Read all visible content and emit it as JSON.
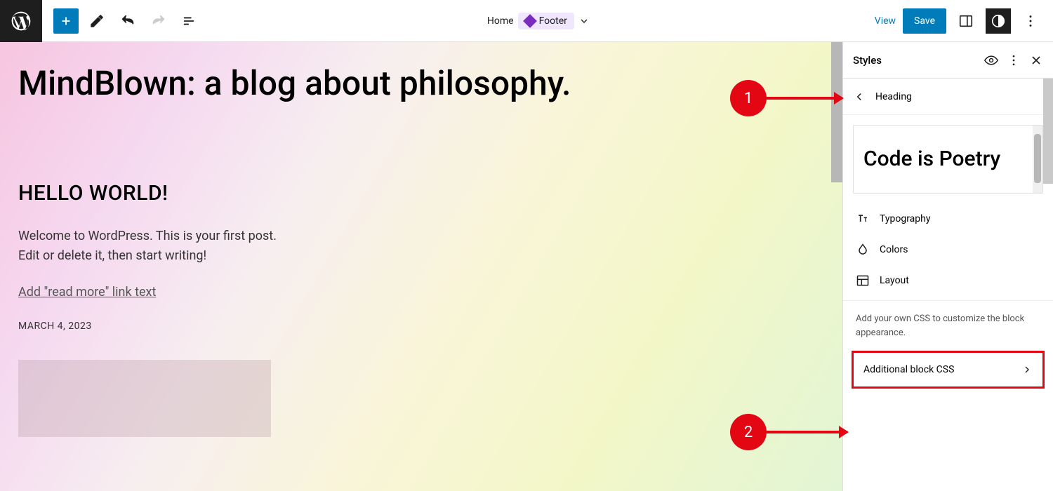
{
  "toolbar": {
    "center_home": "Home",
    "center_footer": "Footer",
    "view_label": "View",
    "save_label": "Save"
  },
  "canvas": {
    "site_title": "MindBlown: a blog about philosophy.",
    "post_title": "HELLO WORLD!",
    "post_excerpt": "Welcome to WordPress. This is your first post. Edit or delete it, then start writing!",
    "readmore_label": "Add \"read more\" link text",
    "post_date": "MARCH 4, 2023"
  },
  "sidebar": {
    "title": "Styles",
    "breadcrumb": "Heading",
    "preview_text": "Code is Poetry",
    "sections": {
      "typography": "Typography",
      "colors": "Colors",
      "layout": "Layout"
    },
    "css_hint": "Add your own CSS to customize the block appearance.",
    "additional_css": "Additional block CSS"
  },
  "annotations": {
    "one": "1",
    "two": "2"
  }
}
